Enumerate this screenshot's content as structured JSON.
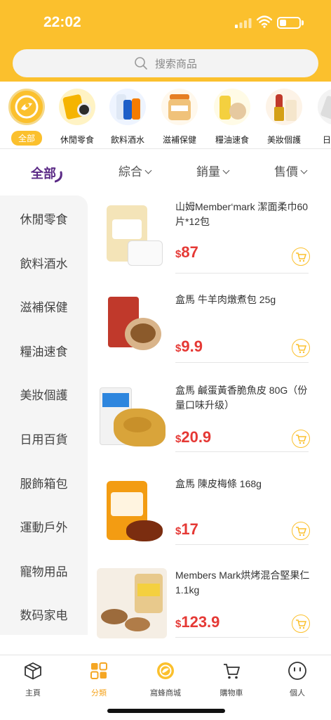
{
  "status": {
    "time": "22:02",
    "battery_level": 0.35
  },
  "search": {
    "placeholder": "搜索商品"
  },
  "categories": [
    {
      "label": "全部",
      "icon": "all-category-icon"
    },
    {
      "label": "休閒零食",
      "icon": "snack-icon"
    },
    {
      "label": "飲料酒水",
      "icon": "drink-icon"
    },
    {
      "label": "滋補保健",
      "icon": "supplement-icon"
    },
    {
      "label": "糧油速食",
      "icon": "grain-oil-icon"
    },
    {
      "label": "美妝個護",
      "icon": "cosmetics-icon"
    },
    {
      "label": "日月",
      "icon": "daily-goods-icon"
    }
  ],
  "sort": {
    "all_label": "全部",
    "options": [
      "綜合",
      "銷量",
      "售價"
    ]
  },
  "sidebar": {
    "items": [
      "休閒零食",
      "飲料酒水",
      "滋補保健",
      "糧油速食",
      "美妝個護",
      "日用百貨",
      "服飾箱包",
      "運動戶外",
      "寵物用品",
      "数码家电"
    ]
  },
  "products": [
    {
      "title": "山姆Member‘mark 潔面柔巾60片*12包",
      "currency": "$",
      "price": "87"
    },
    {
      "title": "盒馬 牛羊肉燉煮包 25g",
      "currency": "$",
      "price": "9.9"
    },
    {
      "title": "盒馬 鹹蛋黃香脆魚皮 80G（份量口味升级）",
      "currency": "$",
      "price": "20.9"
    },
    {
      "title": "盒馬 陳皮梅條 168g",
      "currency": "$",
      "price": "17"
    },
    {
      "title": "Members Mark烘烤混合堅果仁1.1kg",
      "currency": "$",
      "price": "123.9"
    }
  ],
  "tabbar": {
    "items": [
      "主頁",
      "分類",
      "窩蜂商城",
      "購物車",
      "個人"
    ]
  },
  "colors": {
    "accent": "#fbc02d",
    "price": "#e53935",
    "active_sort": "#5b2a86"
  }
}
